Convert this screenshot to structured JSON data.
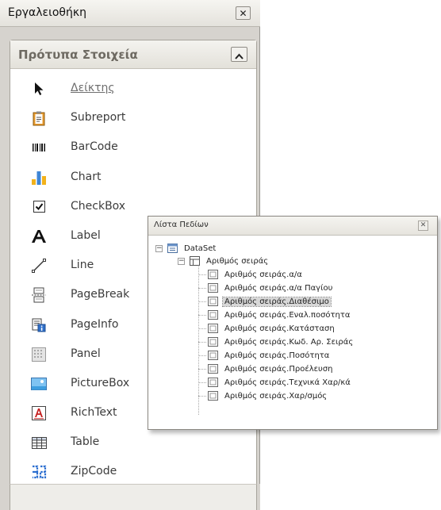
{
  "toolbox": {
    "title": "Εργαλειοθήκη",
    "close_glyph": "✕",
    "section": {
      "title": "Πρότυπα Στοιχεία",
      "items": [
        {
          "label": "Δείκτης",
          "icon": "pointer-arrow-icon"
        },
        {
          "label": "Subreport",
          "icon": "subreport-icon"
        },
        {
          "label": "BarCode",
          "icon": "barcode-icon"
        },
        {
          "label": "Chart",
          "icon": "chart-icon"
        },
        {
          "label": "CheckBox",
          "icon": "checkbox-icon"
        },
        {
          "label": "Label",
          "icon": "label-icon"
        },
        {
          "label": "Line",
          "icon": "line-icon"
        },
        {
          "label": "PageBreak",
          "icon": "pagebreak-icon"
        },
        {
          "label": "PageInfo",
          "icon": "pageinfo-icon"
        },
        {
          "label": "Panel",
          "icon": "panel-icon"
        },
        {
          "label": "PictureBox",
          "icon": "picturebox-icon"
        },
        {
          "label": "RichText",
          "icon": "richtext-icon"
        },
        {
          "label": "Table",
          "icon": "table-icon"
        },
        {
          "label": "ZipCode",
          "icon": "zipcode-icon"
        }
      ]
    }
  },
  "field_list": {
    "title": "Λίστα Πεδίων",
    "close_glyph": "✕",
    "root": {
      "label": "DataSet",
      "expander": "−"
    },
    "table": {
      "label": "Αριθμός σειράς",
      "expander": "−"
    },
    "fields": [
      {
        "label": "Αριθμός σειράς.α/α",
        "selected": false
      },
      {
        "label": "Αριθμός σειράς.α/α Παγίου",
        "selected": false
      },
      {
        "label": "Αριθμός σειράς.Διαθέσιμο",
        "selected": true
      },
      {
        "label": "Αριθμός σειράς.Εναλ.ποσότητα",
        "selected": false
      },
      {
        "label": "Αριθμός σειράς.Κατάσταση",
        "selected": false
      },
      {
        "label": "Αριθμός σειράς.Κωδ. Αρ. Σειράς",
        "selected": false
      },
      {
        "label": "Αριθμός σειράς.Ποσότητα",
        "selected": false
      },
      {
        "label": "Αριθμός σειράς.Προέλευση",
        "selected": false
      },
      {
        "label": "Αριθμός σειράς.Τεχνικά Χαρ/κά",
        "selected": false
      },
      {
        "label": "Αριθμός σειράς.Χαρ/σμός",
        "selected": false
      }
    ]
  },
  "colors": {
    "window_bg": "#d6d3ce",
    "section_title": "#6e6a62",
    "selection_bg": "#d7d7d7"
  }
}
